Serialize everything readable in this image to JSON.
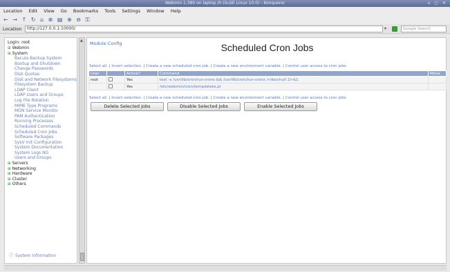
{
  "window": {
    "title": "Webmin 1.380 on laptop /h (SuSE Linux 10.0) - Konqueror",
    "controls": "▫ ▢ ✕"
  },
  "menubar": [
    "Location",
    "Edit",
    "View",
    "Go",
    "Bookmarks",
    "Tools",
    "Settings",
    "Window",
    "Help"
  ],
  "toolbar_icons": [
    "back-icon",
    "forward-icon",
    "up-icon",
    "reload-icon",
    "home-icon",
    "stop-icon",
    "print-icon",
    "zoom-in-icon",
    "zoom-out-icon",
    "security-icon"
  ],
  "location": {
    "label": "Location",
    "url": "http://127.0.0.1:10000/",
    "search_placeholder": "Google Search"
  },
  "sidebar": {
    "login": "Login: root",
    "items": [
      {
        "label": "Webmin",
        "level": 0
      },
      {
        "label": "System",
        "level": 0
      },
      {
        "label": "Bacula Backup System",
        "level": 1
      },
      {
        "label": "Bootup and Shutdown",
        "level": 1
      },
      {
        "label": "Change Passwords",
        "level": 1
      },
      {
        "label": "Disk Quotas",
        "level": 1
      },
      {
        "label": "Disk and Network Filesystems",
        "level": 1
      },
      {
        "label": "Filesystem Backup",
        "level": 1
      },
      {
        "label": "LDAP Client",
        "level": 1
      },
      {
        "label": "LDAP Users and Groups",
        "level": 1
      },
      {
        "label": "Log File Rotation",
        "level": 1
      },
      {
        "label": "MIME Type Programs",
        "level": 1
      },
      {
        "label": "MON Service Monitor",
        "level": 1
      },
      {
        "label": "PAM Authentication",
        "level": 1
      },
      {
        "label": "Running Processes",
        "level": 1
      },
      {
        "label": "Scheduled Commands",
        "level": 1
      },
      {
        "label": "Scheduled Cron Jobs",
        "level": 1
      },
      {
        "label": "Software Packages",
        "level": 1
      },
      {
        "label": "SysV Init Configuration",
        "level": 1
      },
      {
        "label": "System Documentation",
        "level": 1
      },
      {
        "label": "System Logs NG",
        "level": 1
      },
      {
        "label": "Users and Groups",
        "level": 1
      },
      {
        "label": "Servers",
        "level": 0
      },
      {
        "label": "Networking",
        "level": 0
      },
      {
        "label": "Hardware",
        "level": 0
      },
      {
        "label": "Cluster",
        "level": 0
      },
      {
        "label": "Others",
        "level": 0
      }
    ],
    "system_info": "System Information"
  },
  "main": {
    "module_config": "Module Config",
    "title": "Scheduled Cron Jobs",
    "links": {
      "select_all": "Select all.",
      "invert": "Invert selection.",
      "create_job": "Create a new scheduled cron job.",
      "create_env": "Create a new environment variable.",
      "control_access": "Control user access to cron jobs"
    },
    "table": {
      "headers": [
        "User",
        "",
        "Active?",
        "Command",
        "Move"
      ],
      "rows": [
        {
          "user": "root",
          "active": "Yes",
          "command": "test -x /usr/lib/cron/run-crons && /usr/lib/cron/run-crons >/dev/null 2>&1"
        },
        {
          "user": "",
          "active": "Yes",
          "command": "/etc/webmin/cron/tempdelete.pl"
        }
      ]
    },
    "buttons": {
      "delete": "Delete Selected Jobs",
      "disable": "Disable Selected Jobs",
      "enable": "Enable Selected Jobs"
    }
  }
}
